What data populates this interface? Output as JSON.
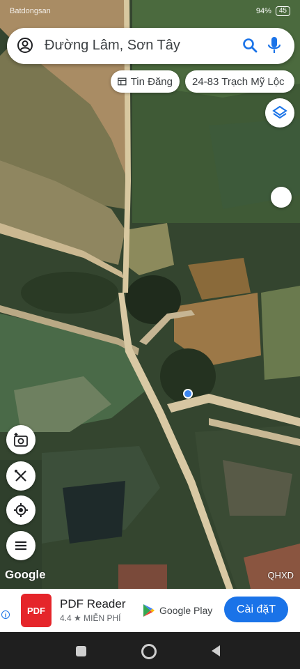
{
  "status_bar": {
    "left_text": "Batdongsan",
    "right_text": "94%",
    "battery": "45"
  },
  "search": {
    "query": "Đường Lâm, Sơn Tây"
  },
  "chips": [
    {
      "label": "Tin Đăng"
    },
    {
      "label": "24-83 Trạch Mỹ Lộc"
    }
  ],
  "map": {
    "watermark": "Google",
    "plus_code": "QHXD"
  },
  "ad": {
    "app_icon_text": "PDF",
    "title": "PDF Reader",
    "rating": "4.4 ★  MIỄN PHÍ",
    "store": "Google Play",
    "install_label": "Cài đặT"
  },
  "icons": {
    "account": "account-icon",
    "search": "search-icon",
    "mic": "mic-icon",
    "layers": "layers-icon",
    "camera": "add-photo-icon",
    "measure": "measure-icon",
    "location": "my-location-icon",
    "menu": "menu-icon"
  },
  "colors": {
    "accent": "#1a73e8",
    "location_dot": "#3d86f2",
    "ad_icon": "#e5252a"
  }
}
